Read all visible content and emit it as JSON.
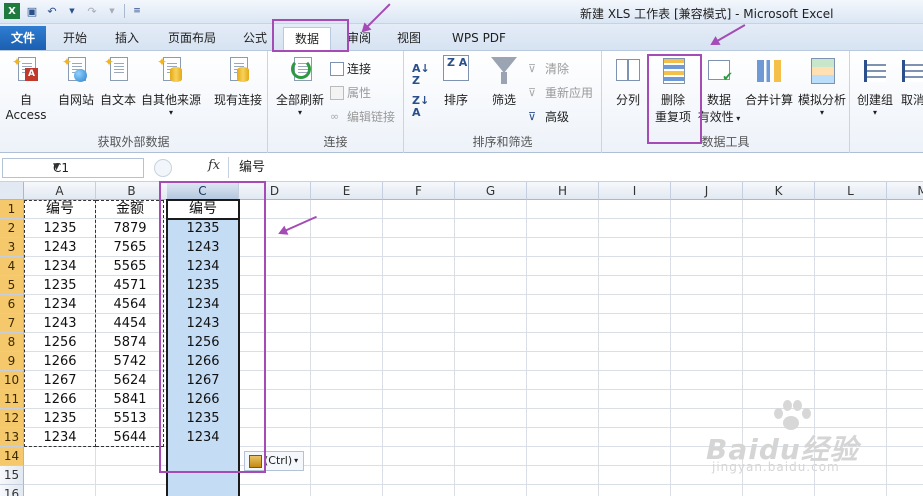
{
  "window": {
    "title": "新建 XLS 工作表  [兼容模式]  -  Microsoft Excel"
  },
  "tabs": [
    {
      "label": "文件"
    },
    {
      "label": "开始"
    },
    {
      "label": "插入"
    },
    {
      "label": "页面布局"
    },
    {
      "label": "公式"
    },
    {
      "label": "数据"
    },
    {
      "label": "审阅"
    },
    {
      "label": "视图"
    },
    {
      "label": "WPS PDF"
    }
  ],
  "ribbon": {
    "get_external": {
      "label": "获取外部数据",
      "access": "自 Access",
      "web": "自网站",
      "text": "自文本",
      "other": "自其他来源",
      "existing": "现有连接"
    },
    "connections": {
      "label": "连接",
      "refresh_all": "全部刷新",
      "connections": "连接",
      "properties": "属性",
      "edit_links": "编辑链接"
    },
    "sort_filter": {
      "label": "排序和筛选",
      "sort": "排序",
      "filter": "筛选",
      "clear": "清除",
      "reapply": "重新应用",
      "advanced": "高级"
    },
    "data_tools": {
      "label": "数据工具",
      "text_to_columns": "分列",
      "remove_dup_line1": "删除",
      "remove_dup_line2": "重复项",
      "validation_line1": "数据",
      "validation_line2": "有效性",
      "consolidate": "合并计算",
      "whatif": "模拟分析"
    },
    "outline": {
      "group": "创建组",
      "ungroup": "取消"
    }
  },
  "formula_bar": {
    "name_box": "C1",
    "fx": "fx",
    "content": "编号"
  },
  "sheet": {
    "columns": [
      "A",
      "B",
      "C",
      "D",
      "E",
      "F",
      "G",
      "H",
      "I",
      "J",
      "K",
      "L",
      "M"
    ],
    "rows": [
      "1",
      "2",
      "3",
      "4",
      "5",
      "6",
      "7",
      "8",
      "9",
      "10",
      "11",
      "12",
      "13",
      "14",
      "15",
      "16"
    ],
    "header_a": "编号",
    "header_b": "金额",
    "header_c": "编号",
    "col_a": [
      "1235",
      "1243",
      "1234",
      "1235",
      "1234",
      "1243",
      "1256",
      "1266",
      "1267",
      "1266",
      "1235",
      "1234"
    ],
    "col_b": [
      "7879",
      "7565",
      "5565",
      "4571",
      "4564",
      "4454",
      "5874",
      "5742",
      "5624",
      "5841",
      "5513",
      "5644"
    ],
    "col_c": [
      "1235",
      "1243",
      "1234",
      "1235",
      "1234",
      "1243",
      "1256",
      "1266",
      "1267",
      "1266",
      "1235",
      "1234"
    ],
    "paste_options": "(Ctrl)"
  },
  "watermark": {
    "brand": "Baidu经验",
    "url": "jingyan.baidu.com"
  },
  "colors": {
    "annotation": "#a44bb6",
    "selection": "#c5dcf5",
    "file_tab": "#1c5fb0"
  }
}
